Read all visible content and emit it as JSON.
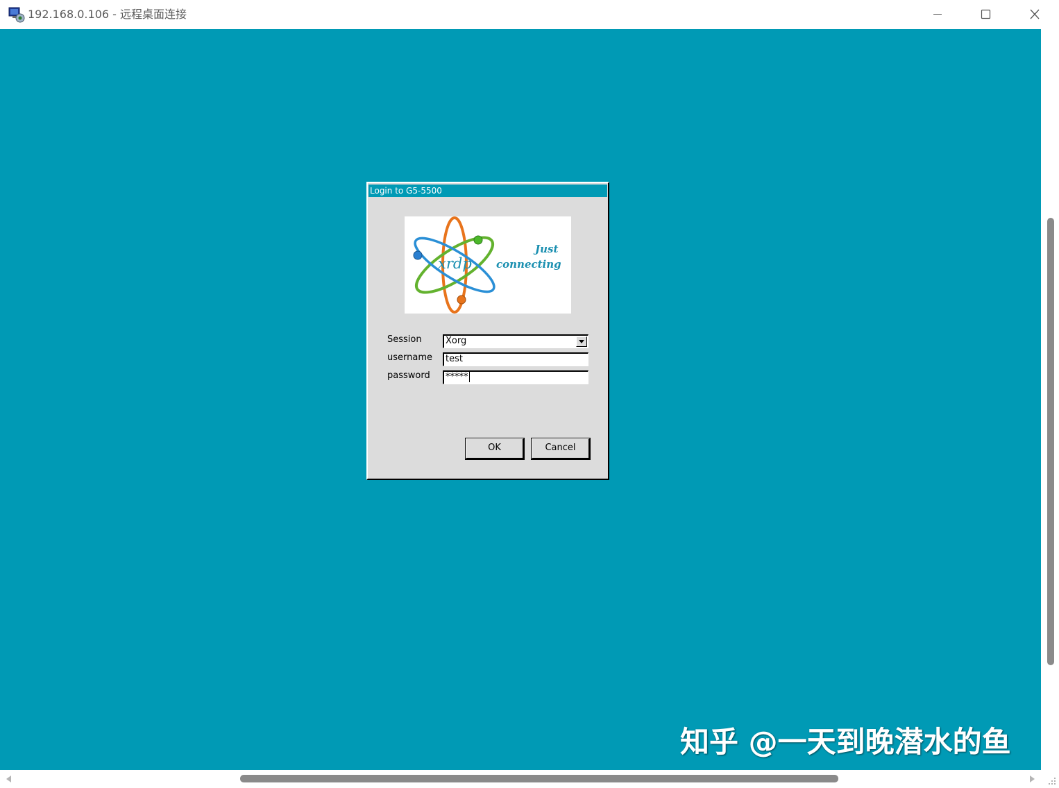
{
  "window": {
    "title": "192.168.0.106 - 远程桌面连接",
    "icon": "remote-desktop-icon",
    "controls": [
      "minimize-icon",
      "maximize-icon",
      "close-icon"
    ]
  },
  "desktop": {
    "background_color": "#009ab5"
  },
  "dialog": {
    "title": "Login to G5-5500",
    "logo": {
      "word": "xrdp",
      "tagline_line1": "Just",
      "tagline_line2": "connecting"
    },
    "fields": {
      "session_label": "Session",
      "session_value": "Xorg",
      "username_label": "username",
      "username_value": "test",
      "password_label": "password",
      "password_value": "*****"
    },
    "buttons": {
      "ok_label": "OK",
      "cancel_label": "Cancel"
    }
  },
  "watermark": {
    "text": "知乎 @一天到晚潜水的鱼"
  }
}
